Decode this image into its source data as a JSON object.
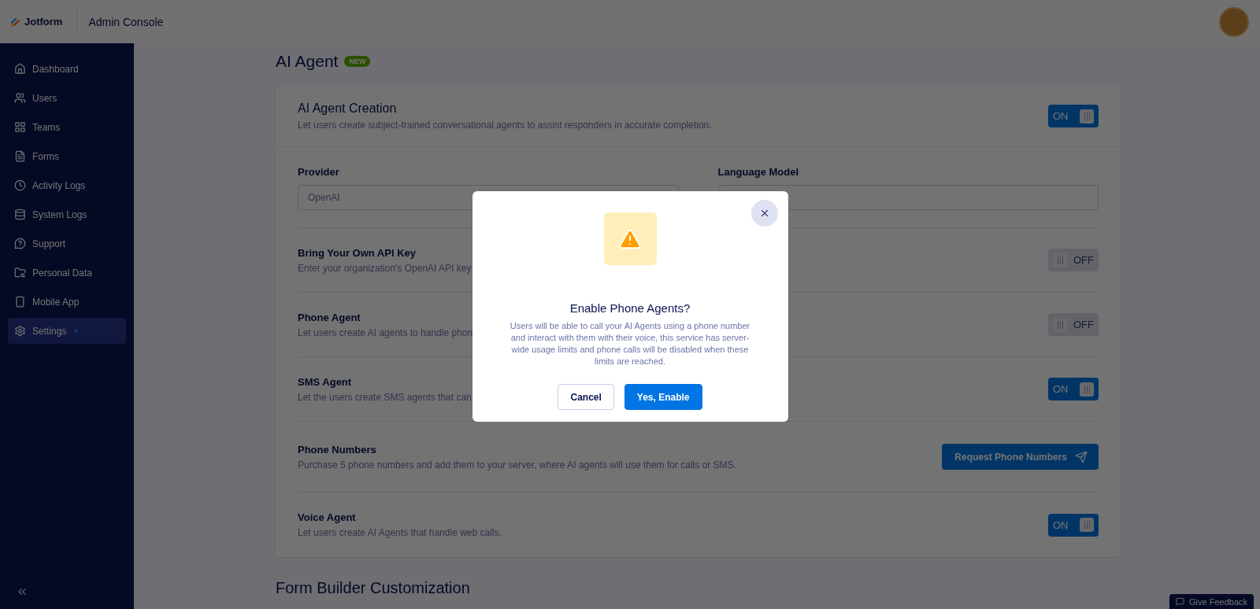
{
  "header": {
    "logo_text": "Jotform",
    "title": "Admin Console"
  },
  "sidebar": {
    "items": [
      {
        "label": "Dashboard",
        "selected": false,
        "dot": false
      },
      {
        "label": "Users",
        "selected": false,
        "dot": false
      },
      {
        "label": "Teams",
        "selected": false,
        "dot": false
      },
      {
        "label": "Forms",
        "selected": false,
        "dot": false
      },
      {
        "label": "Activity Logs",
        "selected": false,
        "dot": false
      },
      {
        "label": "System Logs",
        "selected": false,
        "dot": false
      },
      {
        "label": "Support",
        "selected": false,
        "dot": false
      },
      {
        "label": "Personal Data",
        "selected": false,
        "dot": false
      },
      {
        "label": "Mobile App",
        "selected": false,
        "dot": false
      },
      {
        "label": "Settings",
        "selected": true,
        "dot": true
      }
    ]
  },
  "page_title": "AI Agent",
  "page_badge": "NEW",
  "card": {
    "title": "AI Agent Creation",
    "description": "Let users create subject-trained conversational agents to assist responders in accurate completion.",
    "toggle": {
      "label": "ON",
      "on": true
    }
  },
  "fields": [
    {
      "label": "Provider",
      "value": "OpenAI"
    },
    {
      "label": "Language Model"
    }
  ],
  "settings": [
    {
      "kind": "toggle",
      "title": "Bring Your Own API Key",
      "description": "Enter your organization's OpenAI API key",
      "toggle": {
        "label": "OFF",
        "on": false
      }
    },
    {
      "kind": "toggle",
      "title": "Phone Agent",
      "description": "Let users create AI agents to handle phon",
      "toggle": {
        "label": "OFF",
        "on": false
      }
    },
    {
      "kind": "toggle",
      "title": "SMS Agent",
      "description": "Let the users create SMS agents that can",
      "toggle": {
        "label": "ON",
        "on": true
      }
    },
    {
      "kind": "button",
      "title": "Phone Numbers",
      "description": "Purchase 5 phone numbers and add them to your server, where AI agents will use them for calls or SMS.",
      "button": "Request Phone Numbers"
    },
    {
      "kind": "toggle",
      "title": "Voice Agent",
      "description": "Let users create AI Agents that handle web calls.",
      "toggle": {
        "label": "ON",
        "on": true
      }
    }
  ],
  "next_section": "Form Builder Customization",
  "feedback_button": "Give Feedback",
  "dialog": {
    "title": "Enable Phone Agents?",
    "message": "Users will be able to call your AI Agents using a phone number and interact with them with their voice, this service has server-wide usage limits and phone calls will be disabled when these limits are reached.",
    "buttons": [
      {
        "label": "Cancel",
        "primary": false
      },
      {
        "label": "Yes, Enable",
        "primary": true
      }
    ]
  }
}
